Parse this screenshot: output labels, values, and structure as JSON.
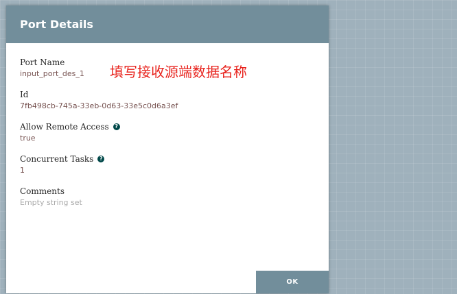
{
  "dialog": {
    "title": "Port Details",
    "ok_label": "OK"
  },
  "fields": {
    "port_name": {
      "label": "Port Name",
      "value": "input_port_des_1"
    },
    "id": {
      "label": "Id",
      "value": "7fb498cb-745a-33eb-0d63-33e5c0d6a3ef"
    },
    "allow_remote_access": {
      "label": "Allow Remote Access",
      "value": "true"
    },
    "concurrent_tasks": {
      "label": "Concurrent Tasks",
      "value": "1"
    },
    "comments": {
      "label": "Comments",
      "value": "Empty string set"
    }
  },
  "annotation": "填写接收源端数据名称",
  "icons": {
    "help": "question-circle-icon",
    "help_glyph": "?"
  },
  "colors": {
    "header": "#728e9b",
    "value_text": "#775351",
    "empty_text": "#aaaaaa",
    "annotation": "#e8221c",
    "help_icon": "#004849",
    "backdrop": "#9fb1bc"
  }
}
